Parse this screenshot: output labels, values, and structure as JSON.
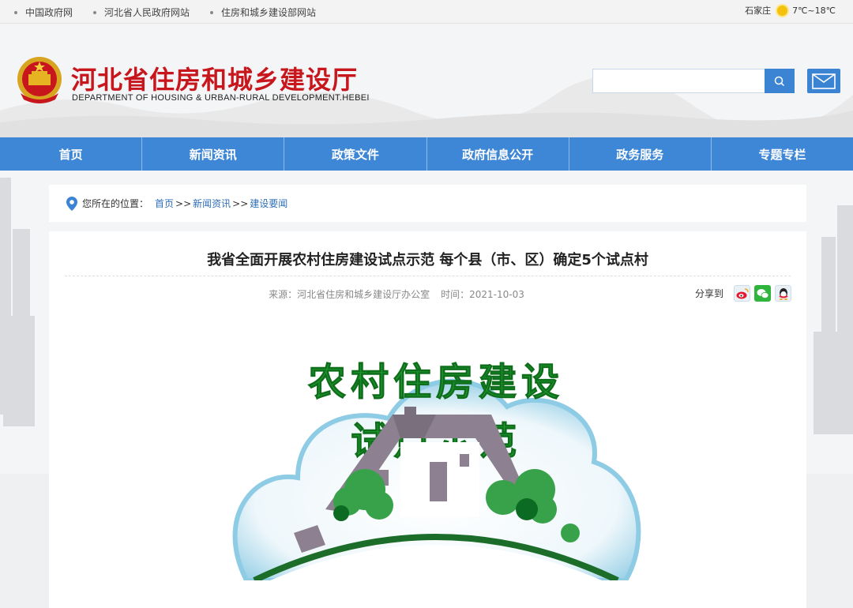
{
  "topbar": {
    "links": [
      "中国政府网",
      "河北省人民政府网站",
      "住房和城乡建设部网站"
    ],
    "city": "石家庄",
    "temperature": "7℃~18℃"
  },
  "header": {
    "title_cn": "河北省住房和城乡建设厅",
    "title_en": "DEPARTMENT OF HOUSING & URBAN-RURAL DEVELOPMENT.HEBEI",
    "search_placeholder": ""
  },
  "nav": {
    "items": [
      "首页",
      "新闻资讯",
      "政策文件",
      "政府信息公开",
      "政务服务",
      "专题专栏"
    ]
  },
  "breadcrumb": {
    "label": "您所在的位置：",
    "items": [
      "首页",
      "新闻资讯",
      "建设要闻"
    ],
    "separator": ">>"
  },
  "article": {
    "title": "我省全面开展农村住房建设试点示范 每个县（市、区）确定5个试点村",
    "source": "来源：河北省住房和城乡建设厅办公室",
    "date": "时间：2021-10-03",
    "share_label": "分享到"
  },
  "hero": {
    "line1": "农村住房建设",
    "line2": "试点示范"
  },
  "colors": {
    "nav": "#3e86d6",
    "title_red": "#c8161d",
    "link_blue": "#2f6fb8",
    "hero_green": "#1f9a2e"
  }
}
